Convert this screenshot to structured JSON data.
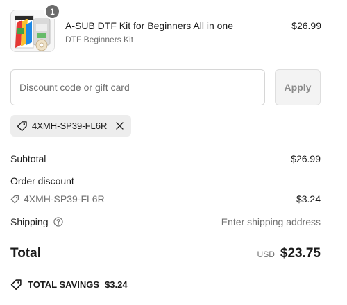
{
  "line_item": {
    "quantity": "1",
    "title": "A-SUB DTF Kit for Beginners All in one",
    "variant": "DTF Beginners Kit",
    "price": "$26.99",
    "image_icon": "product-thumbnail"
  },
  "discount": {
    "placeholder": "Discount code or gift card",
    "value": "",
    "apply_label": "Apply"
  },
  "applied_code": {
    "code": "4XMH-SP39-FL6R",
    "icon": "tag-icon",
    "remove_icon": "close-icon"
  },
  "summary": {
    "subtotal_label": "Subtotal",
    "subtotal_value": "$26.99",
    "order_discount_label": "Order discount",
    "discount_code": "4XMH-SP39-FL6R",
    "discount_value": "– $3.24",
    "shipping_label": "Shipping",
    "shipping_value": "Enter shipping address"
  },
  "total": {
    "label": "Total",
    "currency": "USD",
    "amount": "$23.75"
  },
  "savings": {
    "label": "TOTAL SAVINGS",
    "amount": "$3.24"
  },
  "colors": {
    "text": "#1a1a1a",
    "muted": "#707070",
    "badge": "#6b6b6b",
    "chip_bg": "#ededed",
    "button_bg": "#f3f3f3"
  }
}
